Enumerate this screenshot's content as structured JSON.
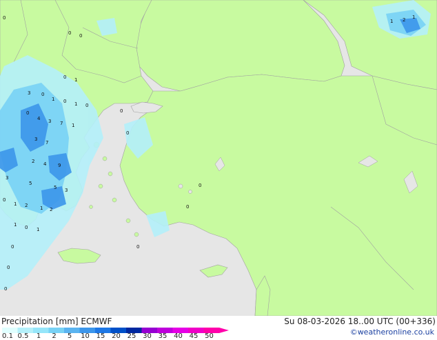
{
  "footer": {
    "title_left": "Precipitation [mm] ECMWF",
    "title_right": "Su 08-03-2026 18..00 UTC (00+336)",
    "credit": "©weatheronline.co.uk"
  },
  "legend": {
    "levels": [
      "0.1",
      "0.5",
      "1",
      "2",
      "5",
      "10",
      "15",
      "20",
      "25",
      "30",
      "35",
      "40",
      "45",
      "50"
    ],
    "colors": [
      "#e0ffff",
      "#b4f0fa",
      "#96e6fa",
      "#78d2f5",
      "#5ab4f0",
      "#3c96eb",
      "#1e78e6",
      "#0050c8",
      "#0028a0",
      "#9600d2",
      "#be00dc",
      "#e600e6",
      "#f000c8",
      "#ff00aa"
    ]
  },
  "colors": {
    "sea": "#e6e6e6",
    "land": "#c8faa0",
    "light_precip": "#b4f0fa",
    "medium_precip": "#78d2f5",
    "heavy_precip": "#3c96eb",
    "border": "#a0a0a0"
  },
  "values": [
    {
      "v": "0"
    },
    {
      "v": "0"
    },
    {
      "v": "0"
    },
    {
      "v": "0"
    },
    {
      "v": "1"
    },
    {
      "v": "2"
    },
    {
      "v": "1"
    },
    {
      "v": "1"
    },
    {
      "v": "1"
    },
    {
      "v": "0"
    },
    {
      "v": "0"
    },
    {
      "v": "0"
    },
    {
      "v": "3"
    },
    {
      "v": "0"
    },
    {
      "v": "1"
    },
    {
      "v": "0"
    },
    {
      "v": "4"
    },
    {
      "v": "3"
    },
    {
      "v": "7"
    },
    {
      "v": "1"
    },
    {
      "v": "3"
    },
    {
      "v": "7"
    },
    {
      "v": "2"
    },
    {
      "v": "4"
    },
    {
      "v": "9"
    },
    {
      "v": "5"
    },
    {
      "v": "3"
    },
    {
      "v": "5"
    },
    {
      "v": "3"
    },
    {
      "v": "0"
    },
    {
      "v": "0"
    },
    {
      "v": "0"
    },
    {
      "v": "1"
    },
    {
      "v": "0"
    },
    {
      "v": "2"
    },
    {
      "v": "1"
    },
    {
      "v": "1"
    },
    {
      "v": "2"
    },
    {
      "v": "1"
    },
    {
      "v": "0"
    },
    {
      "v": "0"
    },
    {
      "v": "0"
    },
    {
      "v": "0"
    },
    {
      "v": "0"
    }
  ]
}
